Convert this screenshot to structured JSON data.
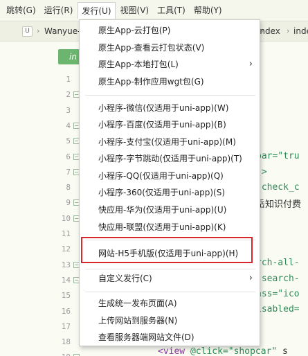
{
  "menubar": {
    "items": [
      {
        "label": "跳转(G)"
      },
      {
        "label": "运行(R)"
      },
      {
        "label": "发行(U)"
      },
      {
        "label": "视图(V)"
      },
      {
        "label": "工具(T)"
      },
      {
        "label": "帮助(Y)"
      }
    ]
  },
  "tabbar": {
    "project_icon": "U",
    "crumb_left": "Wanyue-",
    "crumb_right_1": "index",
    "crumb_right_2": "inde"
  },
  "editor": {
    "tab_label": "in",
    "line_numbers": [
      "1",
      "2",
      "3",
      "4",
      "5",
      "6",
      "7",
      "8",
      "9",
      "10",
      "11",
      "12",
      "13",
      "14",
      "15",
      "16",
      "17",
      "18",
      "19"
    ],
    "code_fragments": [
      "bar=\"tru",
      "\">",
      "\"check_c",
      "岳知识付费",
      "rch-all-",
      "\"search-",
      "ass=\"ico",
      "isabled="
    ],
    "bottom_line": {
      "tag": "<view",
      "attr": " @click=",
      "value": "\"shopcar\"",
      "rest": " s"
    }
  },
  "dropdown": {
    "items": [
      {
        "label": "原生App-云打包(P)"
      },
      {
        "label": "原生App-查看云打包状态(V)"
      },
      {
        "label": "原生App-本地打包(L)"
      },
      {
        "label": "原生App-制作应用wgt包(G)"
      },
      {
        "label": "小程序-微信(仅适用于uni-app)(W)"
      },
      {
        "label": "小程序-百度(仅适用于uni-app)(B)"
      },
      {
        "label": "小程序-支付宝(仅适用于uni-app)(M)"
      },
      {
        "label": "小程序-字节跳动(仅适用于uni-app)(T)"
      },
      {
        "label": "小程序-QQ(仅适用于uni-app)(Q)"
      },
      {
        "label": "小程序-360(仅适用于uni-app)(S)"
      },
      {
        "label": "快应用-华为(仅适用于uni-app)(U)"
      },
      {
        "label": "快应用-联盟(仅适用于uni-app)(K)"
      },
      {
        "label": "网站-H5手机版(仅适用于uni-app)(H)"
      },
      {
        "label": "自定义发行(C)"
      },
      {
        "label": "生成统一发布页面(A)"
      },
      {
        "label": "上传网站到服务器(N)"
      },
      {
        "label": "查看服务器端网站文件(D)"
      }
    ],
    "submenu_arrow": "›"
  },
  "colors": {
    "highlight_border": "#d9262c",
    "editor_tab": "#6bb56e",
    "menubar_bg": "#f5f6ec"
  }
}
